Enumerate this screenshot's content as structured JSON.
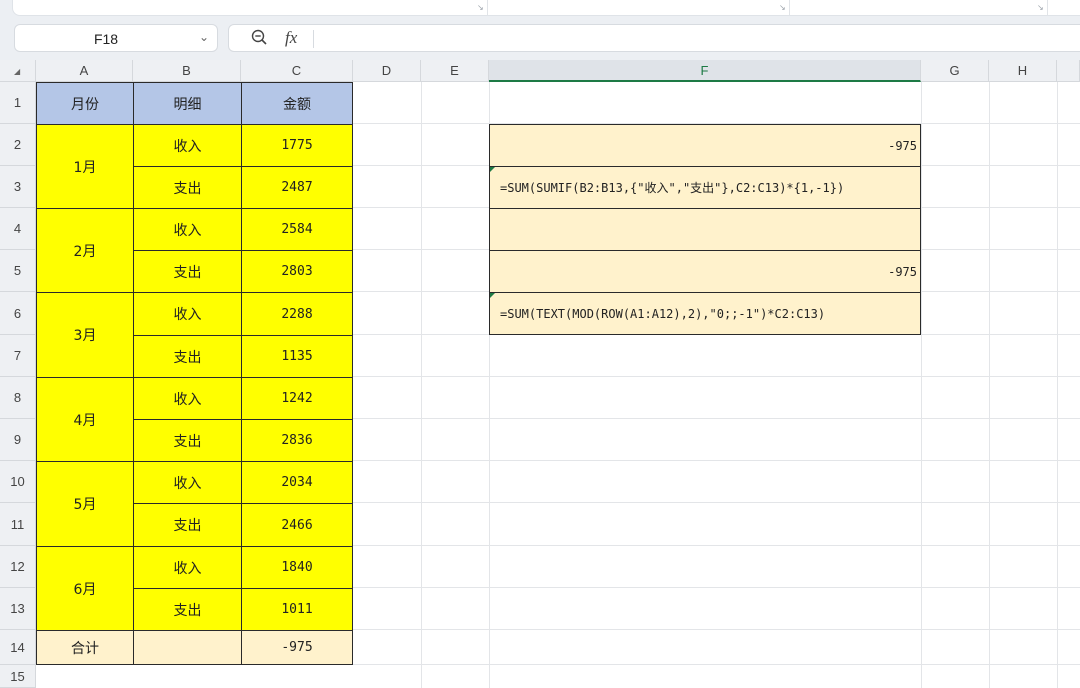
{
  "namebox": {
    "ref": "F18"
  },
  "formula_bar": {
    "fx": "fx",
    "value": ""
  },
  "columns": [
    "A",
    "B",
    "C",
    "D",
    "E",
    "F",
    "G",
    "H"
  ],
  "selected_column": "F",
  "rows": [
    "1",
    "2",
    "3",
    "4",
    "5",
    "6",
    "7",
    "8",
    "9",
    "10",
    "11",
    "12",
    "13",
    "14",
    "15"
  ],
  "table": {
    "headers": [
      "月份",
      "明细",
      "金额"
    ],
    "months": [
      "1月",
      "2月",
      "3月",
      "4月",
      "5月",
      "6月"
    ],
    "details": [
      "收入",
      "支出",
      "收入",
      "支出",
      "收入",
      "支出",
      "收入",
      "支出",
      "收入",
      "支出",
      "收入",
      "支出"
    ],
    "amounts": [
      "1775",
      "2487",
      "2584",
      "2803",
      "2288",
      "1135",
      "1242",
      "2836",
      "2034",
      "2466",
      "1840",
      "1011"
    ],
    "total_label": "合计",
    "total_detail": "",
    "total_value": "-975"
  },
  "side": {
    "f2": "-975",
    "f3": "=SUM(SUMIF(B2:B13,{\"收入\",\"支出\"},C2:C13)*{1,-1})",
    "f4": "",
    "f5": "-975",
    "f6": "=SUM(TEXT(MOD(ROW(A1:A12),2),\"0;;-1\")*C2:C13)"
  },
  "colors": {
    "header_fill": "#b4c6e7",
    "data_fill": "#ffff00",
    "total_fill": "#fff2cc",
    "selection": "#1d7a45"
  }
}
